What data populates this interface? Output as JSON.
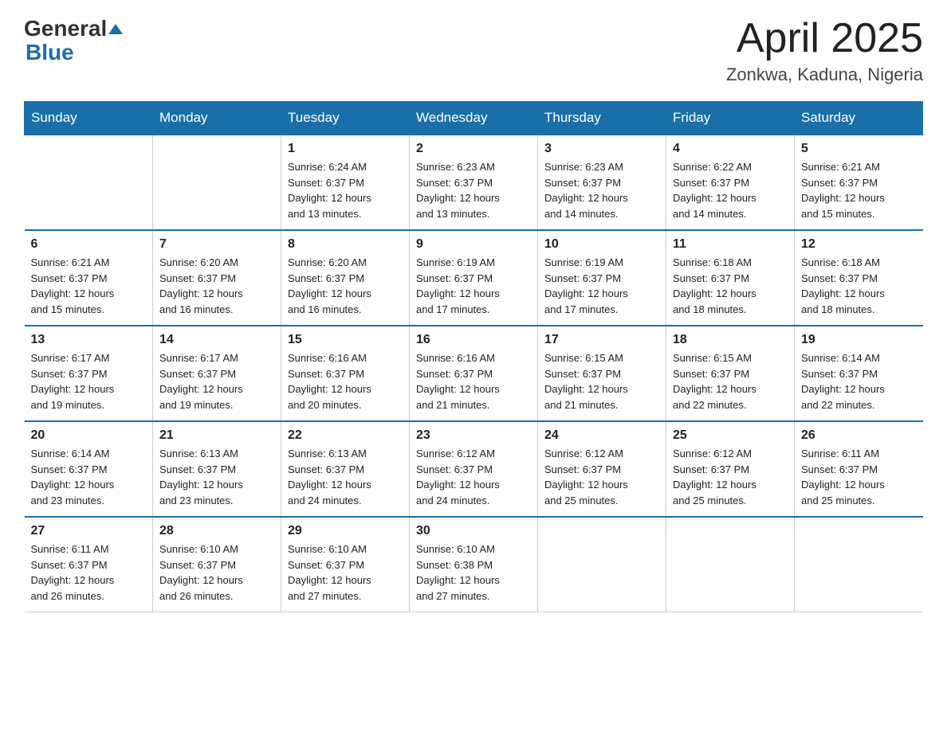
{
  "header": {
    "logo_general": "General",
    "logo_blue": "Blue",
    "month_title": "April 2025",
    "location": "Zonkwa, Kaduna, Nigeria"
  },
  "calendar": {
    "days_of_week": [
      "Sunday",
      "Monday",
      "Tuesday",
      "Wednesday",
      "Thursday",
      "Friday",
      "Saturday"
    ],
    "weeks": [
      [
        {
          "day": "",
          "info": ""
        },
        {
          "day": "",
          "info": ""
        },
        {
          "day": "1",
          "info": "Sunrise: 6:24 AM\nSunset: 6:37 PM\nDaylight: 12 hours\nand 13 minutes."
        },
        {
          "day": "2",
          "info": "Sunrise: 6:23 AM\nSunset: 6:37 PM\nDaylight: 12 hours\nand 13 minutes."
        },
        {
          "day": "3",
          "info": "Sunrise: 6:23 AM\nSunset: 6:37 PM\nDaylight: 12 hours\nand 14 minutes."
        },
        {
          "day": "4",
          "info": "Sunrise: 6:22 AM\nSunset: 6:37 PM\nDaylight: 12 hours\nand 14 minutes."
        },
        {
          "day": "5",
          "info": "Sunrise: 6:21 AM\nSunset: 6:37 PM\nDaylight: 12 hours\nand 15 minutes."
        }
      ],
      [
        {
          "day": "6",
          "info": "Sunrise: 6:21 AM\nSunset: 6:37 PM\nDaylight: 12 hours\nand 15 minutes."
        },
        {
          "day": "7",
          "info": "Sunrise: 6:20 AM\nSunset: 6:37 PM\nDaylight: 12 hours\nand 16 minutes."
        },
        {
          "day": "8",
          "info": "Sunrise: 6:20 AM\nSunset: 6:37 PM\nDaylight: 12 hours\nand 16 minutes."
        },
        {
          "day": "9",
          "info": "Sunrise: 6:19 AM\nSunset: 6:37 PM\nDaylight: 12 hours\nand 17 minutes."
        },
        {
          "day": "10",
          "info": "Sunrise: 6:19 AM\nSunset: 6:37 PM\nDaylight: 12 hours\nand 17 minutes."
        },
        {
          "day": "11",
          "info": "Sunrise: 6:18 AM\nSunset: 6:37 PM\nDaylight: 12 hours\nand 18 minutes."
        },
        {
          "day": "12",
          "info": "Sunrise: 6:18 AM\nSunset: 6:37 PM\nDaylight: 12 hours\nand 18 minutes."
        }
      ],
      [
        {
          "day": "13",
          "info": "Sunrise: 6:17 AM\nSunset: 6:37 PM\nDaylight: 12 hours\nand 19 minutes."
        },
        {
          "day": "14",
          "info": "Sunrise: 6:17 AM\nSunset: 6:37 PM\nDaylight: 12 hours\nand 19 minutes."
        },
        {
          "day": "15",
          "info": "Sunrise: 6:16 AM\nSunset: 6:37 PM\nDaylight: 12 hours\nand 20 minutes."
        },
        {
          "day": "16",
          "info": "Sunrise: 6:16 AM\nSunset: 6:37 PM\nDaylight: 12 hours\nand 21 minutes."
        },
        {
          "day": "17",
          "info": "Sunrise: 6:15 AM\nSunset: 6:37 PM\nDaylight: 12 hours\nand 21 minutes."
        },
        {
          "day": "18",
          "info": "Sunrise: 6:15 AM\nSunset: 6:37 PM\nDaylight: 12 hours\nand 22 minutes."
        },
        {
          "day": "19",
          "info": "Sunrise: 6:14 AM\nSunset: 6:37 PM\nDaylight: 12 hours\nand 22 minutes."
        }
      ],
      [
        {
          "day": "20",
          "info": "Sunrise: 6:14 AM\nSunset: 6:37 PM\nDaylight: 12 hours\nand 23 minutes."
        },
        {
          "day": "21",
          "info": "Sunrise: 6:13 AM\nSunset: 6:37 PM\nDaylight: 12 hours\nand 23 minutes."
        },
        {
          "day": "22",
          "info": "Sunrise: 6:13 AM\nSunset: 6:37 PM\nDaylight: 12 hours\nand 24 minutes."
        },
        {
          "day": "23",
          "info": "Sunrise: 6:12 AM\nSunset: 6:37 PM\nDaylight: 12 hours\nand 24 minutes."
        },
        {
          "day": "24",
          "info": "Sunrise: 6:12 AM\nSunset: 6:37 PM\nDaylight: 12 hours\nand 25 minutes."
        },
        {
          "day": "25",
          "info": "Sunrise: 6:12 AM\nSunset: 6:37 PM\nDaylight: 12 hours\nand 25 minutes."
        },
        {
          "day": "26",
          "info": "Sunrise: 6:11 AM\nSunset: 6:37 PM\nDaylight: 12 hours\nand 25 minutes."
        }
      ],
      [
        {
          "day": "27",
          "info": "Sunrise: 6:11 AM\nSunset: 6:37 PM\nDaylight: 12 hours\nand 26 minutes."
        },
        {
          "day": "28",
          "info": "Sunrise: 6:10 AM\nSunset: 6:37 PM\nDaylight: 12 hours\nand 26 minutes."
        },
        {
          "day": "29",
          "info": "Sunrise: 6:10 AM\nSunset: 6:37 PM\nDaylight: 12 hours\nand 27 minutes."
        },
        {
          "day": "30",
          "info": "Sunrise: 6:10 AM\nSunset: 6:38 PM\nDaylight: 12 hours\nand 27 minutes."
        },
        {
          "day": "",
          "info": ""
        },
        {
          "day": "",
          "info": ""
        },
        {
          "day": "",
          "info": ""
        }
      ]
    ]
  }
}
